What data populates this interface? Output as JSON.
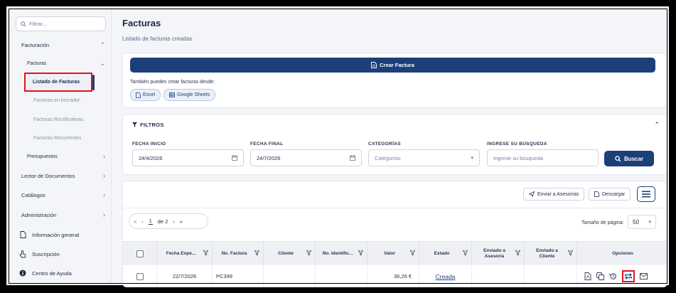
{
  "sidebar": {
    "filter_placeholder": "Filtrar...",
    "facturacion": "Facturación",
    "facturas": "Facturas",
    "listado": "Listado de Facturas",
    "borrador": "Facturas en borrador",
    "rectificativas": "Facturas Rectificativas",
    "recurrentes": "Facturas Recurrentes",
    "presupuestos": "Presupuestos",
    "lector": "Lector de Documentos",
    "catalogos": "Catálogos",
    "administracion": "Administración",
    "info_general": "Información general",
    "suscripcion": "Suscripción",
    "centro_ayuda": "Centro de Ayuda"
  },
  "page": {
    "title": "Facturas",
    "subtitle": "Listado de facturas creadas"
  },
  "create": {
    "button": "Crear Factura",
    "also_label": "También puedes crear facturas desde:",
    "excel": "Excel",
    "sheets": "Google Sheets"
  },
  "filters": {
    "title": "FILTROS",
    "fecha_inicio_label": "FECHA INICIO",
    "fecha_inicio_value": "24/4/2026",
    "fecha_final_label": "FECHA FINAL",
    "fecha_final_value": "24/7/2026",
    "categorias_label": "CATEGORÍAS",
    "categorias_value": "Categorías",
    "busqueda_label": "INGRESE SU BÚSQUEDA",
    "busqueda_placeholder": "Ingrese su búsqueda",
    "buscar": "Buscar"
  },
  "table": {
    "enviar_asesorias": "Enviar a Asesorías",
    "descargar": "Descargar",
    "page_current": "1",
    "page_of": "de 2",
    "page_size_label": "Tamaño de página:",
    "page_size": "50",
    "headers": {
      "fecha": "Fecha Expe...",
      "factura": "No. Factura",
      "cliente": "Cliente",
      "identific": "No. Identific...",
      "valor": "Valor",
      "estado": "Estado",
      "env_asesoria": "Enviado a Asesoría",
      "env_cliente": "Enviado a Cliente",
      "opciones": "Opciones"
    },
    "row": {
      "fecha": "22/7/2026",
      "factura": "PC399",
      "valor": "36,26 €",
      "estado": "Creada"
    }
  },
  "colors": {
    "primary": "#1c3f7a",
    "highlight": "#e0141b"
  }
}
